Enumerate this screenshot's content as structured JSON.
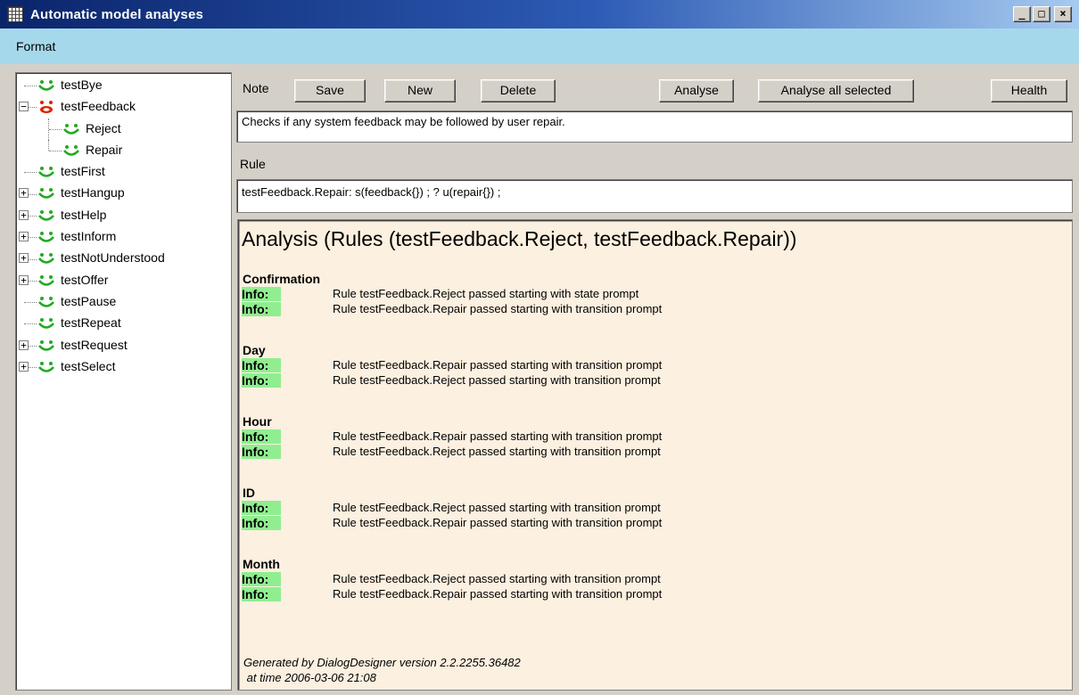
{
  "window": {
    "title": "Automatic model analyses"
  },
  "menu": {
    "items": [
      "Format"
    ]
  },
  "tree": {
    "items": [
      {
        "label": "testBye",
        "depth": 0,
        "expander": "",
        "icon": "green-smiley-icon"
      },
      {
        "label": "testFeedback",
        "depth": 0,
        "expander": "−",
        "icon": "red-face-icon"
      },
      {
        "label": "Reject",
        "depth": 1,
        "expander": "",
        "icon": "green-smiley-icon"
      },
      {
        "label": "Repair",
        "depth": 1,
        "expander": "",
        "icon": "green-smiley-icon"
      },
      {
        "label": "testFirst",
        "depth": 0,
        "expander": "",
        "icon": "green-smiley-icon"
      },
      {
        "label": "testHangup",
        "depth": 0,
        "expander": "+",
        "icon": "green-smiley-icon"
      },
      {
        "label": "testHelp",
        "depth": 0,
        "expander": "+",
        "icon": "green-smiley-icon"
      },
      {
        "label": "testInform",
        "depth": 0,
        "expander": "+",
        "icon": "green-smiley-icon"
      },
      {
        "label": "testNotUnderstood",
        "depth": 0,
        "expander": "+",
        "icon": "green-smiley-icon"
      },
      {
        "label": "testOffer",
        "depth": 0,
        "expander": "+",
        "icon": "green-smiley-icon"
      },
      {
        "label": "testPause",
        "depth": 0,
        "expander": "",
        "icon": "green-smiley-icon"
      },
      {
        "label": "testRepeat",
        "depth": 0,
        "expander": "",
        "icon": "green-smiley-icon"
      },
      {
        "label": "testRequest",
        "depth": 0,
        "expander": "+",
        "icon": "green-smiley-icon"
      },
      {
        "label": "testSelect",
        "depth": 0,
        "expander": "+",
        "icon": "green-smiley-icon"
      }
    ]
  },
  "toolbar": {
    "note_label": "Note",
    "save_label": "Save",
    "new_label": "New",
    "delete_label": "Delete",
    "analyse_label": "Analyse",
    "analyse_all_label": "Analyse all selected",
    "health_label": "Health"
  },
  "note": {
    "value": "Checks if any system feedback may be followed by user repair."
  },
  "rule": {
    "label": "Rule",
    "value": "testFeedback.Repair: s(feedback{}) ;  ? u(repair{}) ;"
  },
  "analysis": {
    "heading": "Analysis (Rules (testFeedback.Reject, testFeedback.Repair))",
    "sections": [
      {
        "title": "Confirmation",
        "messages": [
          {
            "level": "Info:",
            "text": "Rule testFeedback.Reject passed starting with state prompt"
          },
          {
            "level": "Info:",
            "text": "Rule testFeedback.Repair passed starting with transition prompt"
          }
        ]
      },
      {
        "title": "Day",
        "messages": [
          {
            "level": "Info:",
            "text": "Rule testFeedback.Repair passed starting with transition prompt"
          },
          {
            "level": "Info:",
            "text": "Rule testFeedback.Reject passed starting with transition prompt"
          }
        ]
      },
      {
        "title": "Hour",
        "messages": [
          {
            "level": "Info:",
            "text": "Rule testFeedback.Repair passed starting with transition prompt"
          },
          {
            "level": "Info:",
            "text": "Rule testFeedback.Reject passed starting with transition prompt"
          }
        ]
      },
      {
        "title": "ID",
        "messages": [
          {
            "level": "Info:",
            "text": "Rule testFeedback.Reject passed starting with transition prompt"
          },
          {
            "level": "Info:",
            "text": "Rule testFeedback.Repair passed starting with transition prompt"
          }
        ]
      },
      {
        "title": "Month",
        "messages": [
          {
            "level": "Info:",
            "text": "Rule testFeedback.Reject passed starting with transition prompt"
          },
          {
            "level": "Info:",
            "text": "Rule testFeedback.Repair passed starting with transition prompt"
          }
        ]
      }
    ],
    "footer_generated": "Generated by DialogDesigner version 2.2.2255.36482",
    "footer_time": " at time 2006-03-06 21:08"
  },
  "colors": {
    "titlebar_start": "#0a246a",
    "menubar": "#a6d8ec",
    "analysis_bg": "#fcf0e0",
    "info_badge": "#90ee90",
    "smiley_green": "#22aa22",
    "face_red": "#dd2200"
  }
}
